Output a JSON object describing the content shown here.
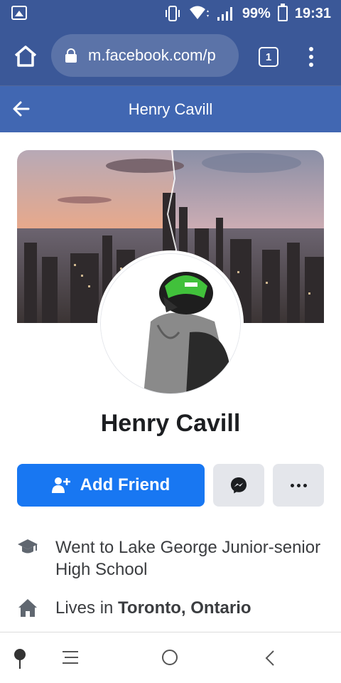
{
  "status_bar": {
    "battery": "99%",
    "time": "19:31",
    "icons": [
      "gallery-icon",
      "vibrate-icon",
      "wifi-icon",
      "signal-icon",
      "battery-icon"
    ]
  },
  "browser": {
    "url": "m.facebook.com/p",
    "tab_count": "1",
    "icons": [
      "home-icon",
      "lock-icon",
      "tabs-icon",
      "overflow-menu-icon"
    ]
  },
  "header": {
    "title": "Henry Cavill"
  },
  "profile": {
    "name": "Henry Cavill",
    "actions": {
      "add_friend_label": "Add Friend"
    }
  },
  "info": {
    "education": "Went to Lake George Junior-senior High School",
    "lives_prefix": "Lives in ",
    "lives_place": "Toronto, Ontario"
  },
  "colors": {
    "status_bar_bg": "#3b5898",
    "header_bg": "#4167b2",
    "primary_button": "#1877f2",
    "secondary_button": "#e4e6eb"
  }
}
